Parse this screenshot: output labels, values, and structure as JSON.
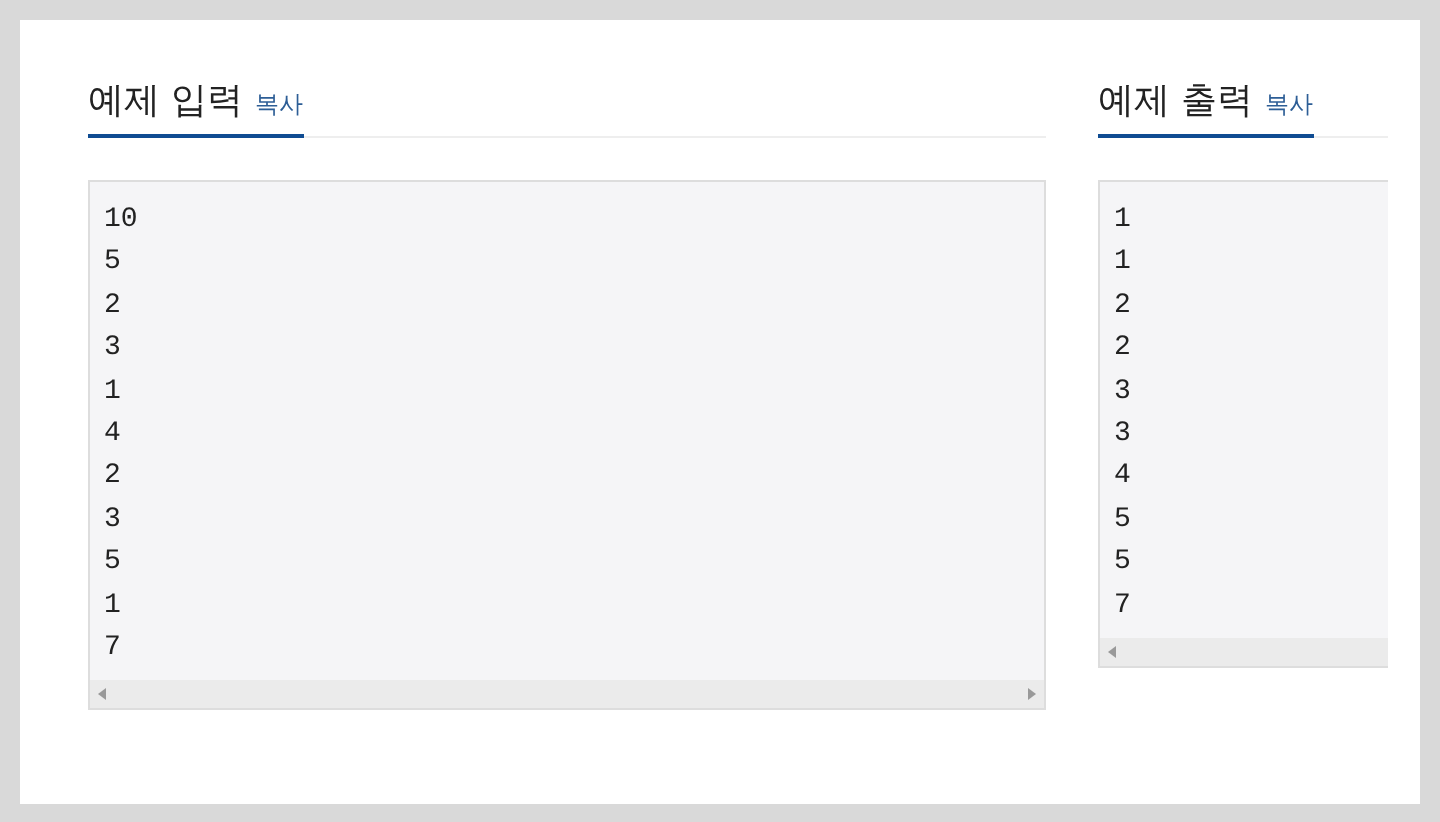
{
  "sections": [
    {
      "title": "예제 입력",
      "copy": "복사",
      "lines": [
        "10",
        "5",
        "2",
        "3",
        "1",
        "4",
        "2",
        "3",
        "5",
        "1",
        "7"
      ]
    },
    {
      "title": "예제 출력",
      "copy": "복사",
      "lines": [
        "1",
        "1",
        "2",
        "2",
        "3",
        "3",
        "4",
        "5",
        "5",
        "7"
      ]
    }
  ]
}
